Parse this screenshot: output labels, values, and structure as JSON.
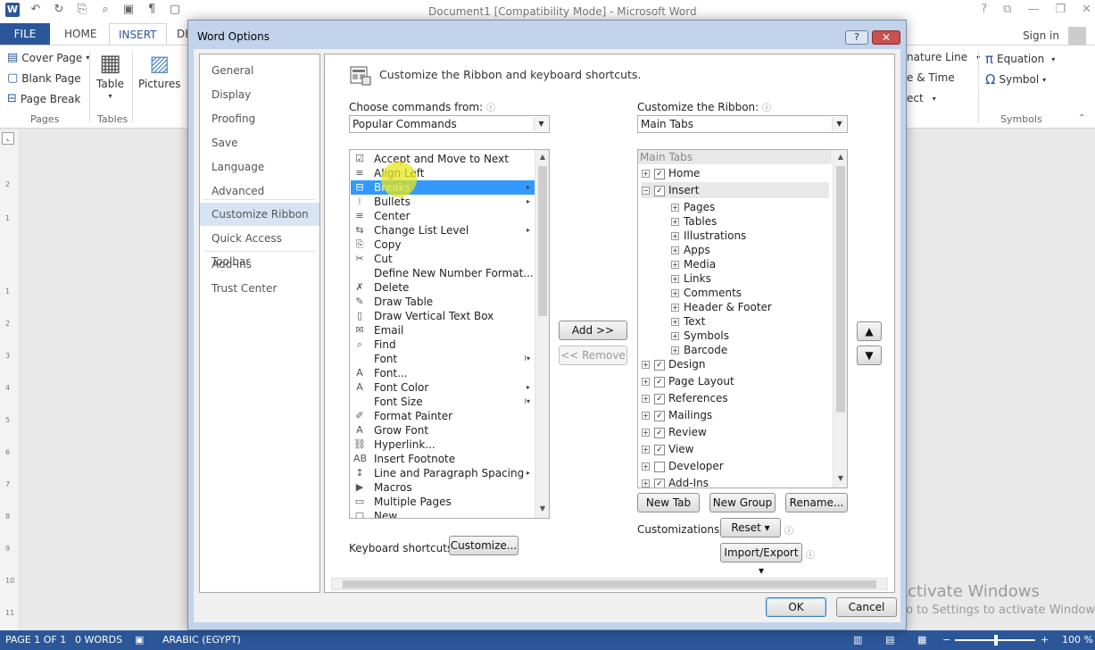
{
  "word": {
    "title": "Document1 [Compatibility Mode] - Microsoft Word",
    "qat_icons": [
      "word-logo-icon",
      "undo-icon",
      "redo-icon",
      "paste-icon",
      "print-preview-icon",
      "save-icon",
      "text-direction-icon",
      "new-document-icon"
    ],
    "window_controls": [
      "?",
      "⧉",
      "—",
      "❐",
      "✕"
    ],
    "tabs": {
      "file": "FILE",
      "home": "HOME",
      "insert": "INSERT",
      "design": "DE"
    },
    "sign_in": "Sign in",
    "ribbon": {
      "pages": {
        "cover_page": "Cover Page",
        "blank_page": "Blank Page",
        "page_break": "Page Break",
        "label": "Pages"
      },
      "tables": {
        "table": "Table",
        "label": "Tables"
      },
      "pictures": "Pictures",
      "right": {
        "signature_line": "nature Line",
        "date_time": "e & Time",
        "object": "ect",
        "equation": "Equation",
        "symbol": "Symbol",
        "symbols_label": "Symbols"
      }
    },
    "ruler_ticks": [
      "2",
      "1",
      "1",
      "2",
      "3",
      "4",
      "5",
      "6",
      "7",
      "8",
      "9",
      "10",
      "11"
    ],
    "status": {
      "page": "PAGE 1 OF 1",
      "words": "0 WORDS",
      "language": "ARABIC (EGYPT)",
      "zoom": "100 %"
    },
    "watermark": {
      "title": "Activate Windows",
      "subtitle": "Go to Settings to activate Windows."
    }
  },
  "dialog": {
    "title": "Word Options",
    "help": "?",
    "close": "✕",
    "nav": [
      {
        "label": "General",
        "active": false
      },
      {
        "label": "Display",
        "active": false
      },
      {
        "label": "Proofing",
        "active": false
      },
      {
        "label": "Save",
        "active": false
      },
      {
        "label": "Language",
        "active": false
      },
      {
        "label": "Advanced",
        "active": false
      },
      {
        "label": "Customize Ribbon",
        "active": true
      },
      {
        "label": "Quick Access Toolbar",
        "active": false
      },
      {
        "label": "Add-Ins",
        "active": false
      },
      {
        "label": "Trust Center",
        "active": false
      }
    ],
    "header": "Customize the Ribbon and keyboard shortcuts.",
    "choose_commands": {
      "label": "Choose commands from:",
      "value": "Popular Commands"
    },
    "customize_ribbon": {
      "label": "Customize the Ribbon:",
      "value": "Main Tabs"
    },
    "commands": [
      {
        "label": "Accept and Move to Next",
        "icon": "☑",
        "sub": ""
      },
      {
        "label": "Align Left",
        "icon": "≡",
        "sub": ""
      },
      {
        "label": "Breaks",
        "icon": "⊟",
        "sub": "▸",
        "selected": true
      },
      {
        "label": "Bullets",
        "icon": "⁝",
        "sub": "▸"
      },
      {
        "label": "Center",
        "icon": "≡",
        "sub": ""
      },
      {
        "label": "Change List Level",
        "icon": "⇆",
        "sub": "▸"
      },
      {
        "label": "Copy",
        "icon": "⎘",
        "sub": ""
      },
      {
        "label": "Cut",
        "icon": "✂",
        "sub": ""
      },
      {
        "label": "Define New Number Format...",
        "icon": "",
        "sub": ""
      },
      {
        "label": "Delete",
        "icon": "✗",
        "sub": ""
      },
      {
        "label": "Draw Table",
        "icon": "✎",
        "sub": ""
      },
      {
        "label": "Draw Vertical Text Box",
        "icon": "▯",
        "sub": ""
      },
      {
        "label": "Email",
        "icon": "✉",
        "sub": ""
      },
      {
        "label": "Find",
        "icon": "⌕",
        "sub": ""
      },
      {
        "label": "Font",
        "icon": "",
        "sub": "I▾"
      },
      {
        "label": "Font...",
        "icon": "A",
        "sub": ""
      },
      {
        "label": "Font Color",
        "icon": "A",
        "sub": "▸"
      },
      {
        "label": "Font Size",
        "icon": "",
        "sub": "I▾"
      },
      {
        "label": "Format Painter",
        "icon": "✐",
        "sub": ""
      },
      {
        "label": "Grow Font",
        "icon": "A",
        "sub": ""
      },
      {
        "label": "Hyperlink...",
        "icon": "⛓",
        "sub": ""
      },
      {
        "label": "Insert Footnote",
        "icon": "AB",
        "sub": ""
      },
      {
        "label": "Line and Paragraph Spacing",
        "icon": "↕",
        "sub": "▸"
      },
      {
        "label": "Macros",
        "icon": "▶",
        "sub": ""
      },
      {
        "label": "Multiple Pages",
        "icon": "▭",
        "sub": ""
      },
      {
        "label": "New",
        "icon": "▢",
        "sub": ""
      }
    ],
    "tabs_tree": {
      "header": "Main Tabs",
      "rows": [
        {
          "label": "Home",
          "level": 0,
          "expander": "+",
          "checked": true
        },
        {
          "label": "Insert",
          "level": 0,
          "expander": "−",
          "checked": true
        },
        {
          "label": "Pages",
          "level": 1,
          "expander": "+"
        },
        {
          "label": "Tables",
          "level": 1,
          "expander": "+"
        },
        {
          "label": "Illustrations",
          "level": 1,
          "expander": "+"
        },
        {
          "label": "Apps",
          "level": 1,
          "expander": "+"
        },
        {
          "label": "Media",
          "level": 1,
          "expander": "+"
        },
        {
          "label": "Links",
          "level": 1,
          "expander": "+"
        },
        {
          "label": "Comments",
          "level": 1,
          "expander": "+"
        },
        {
          "label": "Header & Footer",
          "level": 1,
          "expander": "+"
        },
        {
          "label": "Text",
          "level": 1,
          "expander": "+"
        },
        {
          "label": "Symbols",
          "level": 1,
          "expander": "+"
        },
        {
          "label": "Barcode",
          "level": 1,
          "expander": "+"
        },
        {
          "label": "Design",
          "level": 0,
          "expander": "+",
          "checked": true
        },
        {
          "label": "Page Layout",
          "level": 0,
          "expander": "+",
          "checked": true
        },
        {
          "label": "References",
          "level": 0,
          "expander": "+",
          "checked": true
        },
        {
          "label": "Mailings",
          "level": 0,
          "expander": "+",
          "checked": true
        },
        {
          "label": "Review",
          "level": 0,
          "expander": "+",
          "checked": true
        },
        {
          "label": "View",
          "level": 0,
          "expander": "+",
          "checked": true
        },
        {
          "label": "Developer",
          "level": 0,
          "expander": "+",
          "checked": false
        },
        {
          "label": "Add-Ins",
          "level": 0,
          "expander": "+",
          "checked": true
        }
      ]
    },
    "buttons": {
      "add": "Add >>",
      "remove": "<< Remove",
      "move_up": "▲",
      "move_down": "▼",
      "new_tab": "New Tab",
      "new_group": "New Group",
      "rename": "Rename...",
      "customizations_label": "Customizations:",
      "reset": "Reset ▾",
      "import_export": "Import/Export ▾",
      "keyboard_label": "Keyboard shortcuts:",
      "customize": "Customize...",
      "ok": "OK",
      "cancel": "Cancel"
    },
    "colors": {
      "selection": "#3399ff",
      "nav_active": "#d7e4f3",
      "accent": "#2b579a"
    }
  }
}
